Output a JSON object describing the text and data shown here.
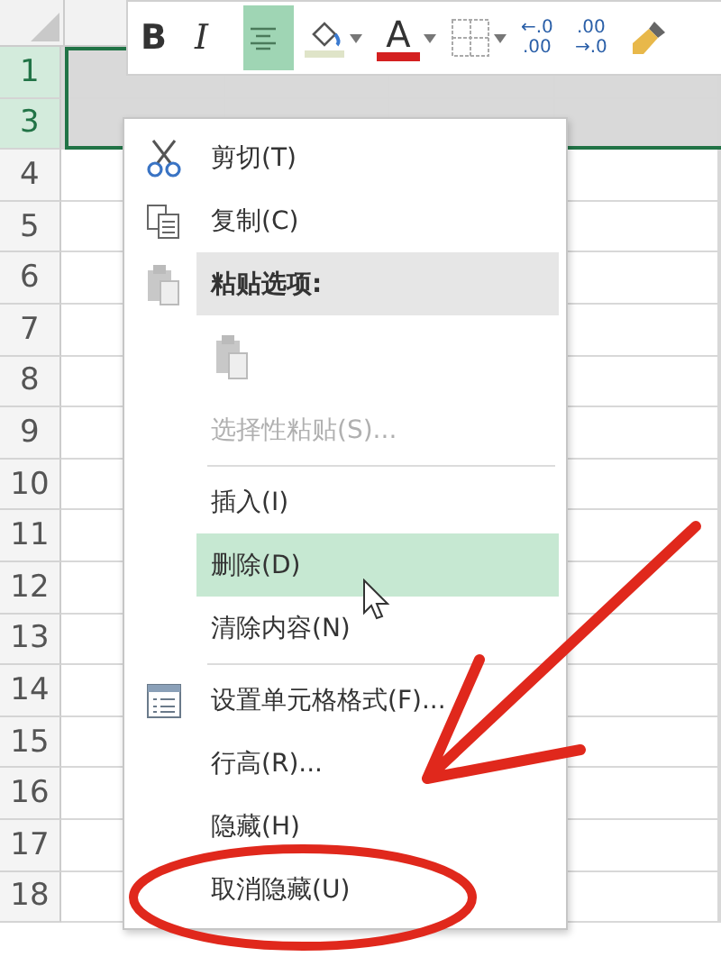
{
  "row_headers": [
    {
      "label": "1",
      "selected": true
    },
    {
      "label": "3",
      "selected": true
    },
    {
      "label": "4",
      "selected": false
    },
    {
      "label": "5",
      "selected": false
    },
    {
      "label": "6",
      "selected": false
    },
    {
      "label": "7",
      "selected": false
    },
    {
      "label": "8",
      "selected": false
    },
    {
      "label": "9",
      "selected": false
    },
    {
      "label": "10",
      "selected": false
    },
    {
      "label": "11",
      "selected": false
    },
    {
      "label": "12",
      "selected": false
    },
    {
      "label": "13",
      "selected": false
    },
    {
      "label": "14",
      "selected": false
    },
    {
      "label": "15",
      "selected": false
    },
    {
      "label": "16",
      "selected": false
    },
    {
      "label": "17",
      "selected": false
    },
    {
      "label": "18",
      "selected": false
    }
  ],
  "mini_toolbar": {
    "buttons": [
      {
        "kind": "bold",
        "label": "B",
        "selected": false
      },
      {
        "kind": "italic",
        "label": "I",
        "selected": false
      },
      {
        "kind": "align-center",
        "selected": true
      },
      {
        "kind": "fill-color",
        "selected": false
      },
      {
        "kind": "font-color",
        "label": "A",
        "selected": false
      },
      {
        "kind": "borders",
        "selected": false
      },
      {
        "kind": "decimal",
        "top": "←.0",
        "bottom": ".00",
        "selected": false
      },
      {
        "kind": "decimal",
        "top": ".00",
        "bottom": "→.0",
        "selected": false
      },
      {
        "kind": "format-painter",
        "selected": false
      }
    ]
  },
  "context_menu": {
    "items": [
      {
        "kind": "cut",
        "label": "剪切(T)",
        "disabled": false,
        "selected": false
      },
      {
        "kind": "copy",
        "label": "复制(C)",
        "disabled": false,
        "selected": false
      },
      {
        "kind": "paste-header",
        "label": "粘贴选项:"
      },
      {
        "kind": "paste-options"
      },
      {
        "kind": "item",
        "label": "选择性粘贴(S)...",
        "disabled": true,
        "selected": false
      },
      {
        "kind": "separator"
      },
      {
        "kind": "item",
        "label": "插入(I)",
        "disabled": false,
        "selected": false
      },
      {
        "kind": "item",
        "label": "删除(D)",
        "disabled": false,
        "selected": true
      },
      {
        "kind": "item",
        "label": "清除内容(N)",
        "disabled": false,
        "selected": false
      },
      {
        "kind": "separator"
      },
      {
        "kind": "format-cells",
        "label": "设置单元格格式(F)...",
        "disabled": false,
        "selected": false
      },
      {
        "kind": "item",
        "label": "行高(R)...",
        "disabled": false,
        "selected": false
      },
      {
        "kind": "item",
        "label": "隐藏(H)",
        "disabled": false,
        "selected": false
      },
      {
        "kind": "item",
        "label": "取消隐藏(U)",
        "disabled": false,
        "selected": false
      }
    ]
  }
}
